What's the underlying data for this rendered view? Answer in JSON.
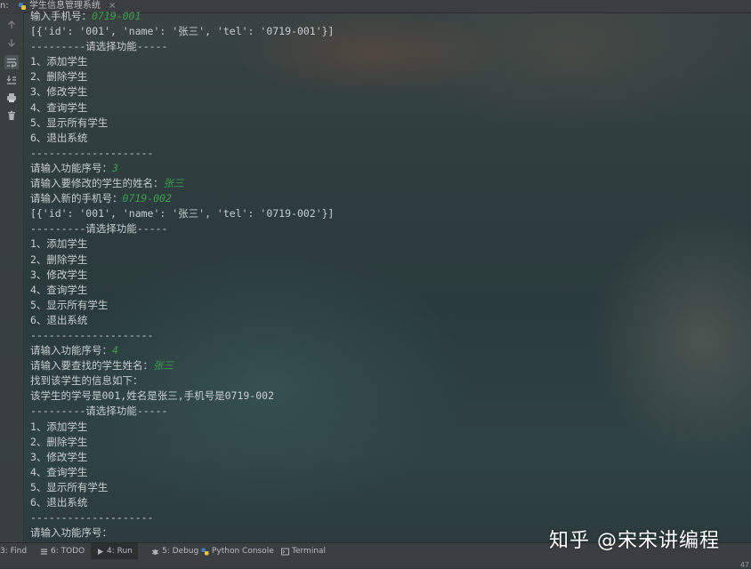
{
  "window": {
    "run_label": "n:",
    "tab_title": "学生信息管理系统",
    "tab_close": "×"
  },
  "console": {
    "lines": [
      {
        "text": "输入手机号：",
        "input": "0719-001"
      },
      {
        "text": "[{'id': '001', 'name': '张三', 'tel': '0719-001'}]",
        "input": ""
      },
      {
        "text": "---------请选择功能-----",
        "input": ""
      },
      {
        "text": "1、添加学生",
        "input": ""
      },
      {
        "text": "2、删除学生",
        "input": ""
      },
      {
        "text": "3、修改学生",
        "input": ""
      },
      {
        "text": "4、查询学生",
        "input": ""
      },
      {
        "text": "5、显示所有学生",
        "input": ""
      },
      {
        "text": "6、退出系统",
        "input": ""
      },
      {
        "text": "--------------------",
        "input": ""
      },
      {
        "text": "请输入功能序号：",
        "input": "3"
      },
      {
        "text": "请输入要修改的学生的姓名：",
        "input": "张三"
      },
      {
        "text": "请输入新的手机号：",
        "input": "0719-002"
      },
      {
        "text": "[{'id': '001', 'name': '张三', 'tel': '0719-002'}]",
        "input": ""
      },
      {
        "text": "---------请选择功能-----",
        "input": ""
      },
      {
        "text": "1、添加学生",
        "input": ""
      },
      {
        "text": "2、删除学生",
        "input": ""
      },
      {
        "text": "3、修改学生",
        "input": ""
      },
      {
        "text": "4、查询学生",
        "input": ""
      },
      {
        "text": "5、显示所有学生",
        "input": ""
      },
      {
        "text": "6、退出系统",
        "input": ""
      },
      {
        "text": "--------------------",
        "input": ""
      },
      {
        "text": "请输入功能序号：",
        "input": "4"
      },
      {
        "text": "请输入要查找的学生姓名：",
        "input": "张三"
      },
      {
        "text": "找到该学生的信息如下：",
        "input": ""
      },
      {
        "text": "该学生的学号是001,姓名是张三,手机号是0719-002",
        "input": ""
      },
      {
        "text": "---------请选择功能-----",
        "input": ""
      },
      {
        "text": "1、添加学生",
        "input": ""
      },
      {
        "text": "2、删除学生",
        "input": ""
      },
      {
        "text": "3、修改学生",
        "input": ""
      },
      {
        "text": "4、查询学生",
        "input": ""
      },
      {
        "text": "5、显示所有学生",
        "input": ""
      },
      {
        "text": "6、退出系统",
        "input": ""
      },
      {
        "text": "--------------------",
        "input": ""
      },
      {
        "text": "请输入功能序号：",
        "input": ""
      }
    ]
  },
  "gutter": {
    "icons": [
      "arrow-up-icon",
      "arrow-down-icon",
      "soft-wrap-icon",
      "scroll-to-end-icon",
      "print-icon",
      "trash-icon"
    ]
  },
  "statusbar": {
    "find": "3: Find",
    "todo": "6: TODO",
    "run": "4: Run",
    "debug": "5: Debug",
    "python_console": "Python Console",
    "terminal": "Terminal",
    "right_number": "47"
  },
  "watermark": "知乎 @宋宋讲编程",
  "colors": {
    "input_text": "#3e9d4f",
    "output_text": "#c9cdd0",
    "toolbar_bg": "#3c3f41"
  }
}
